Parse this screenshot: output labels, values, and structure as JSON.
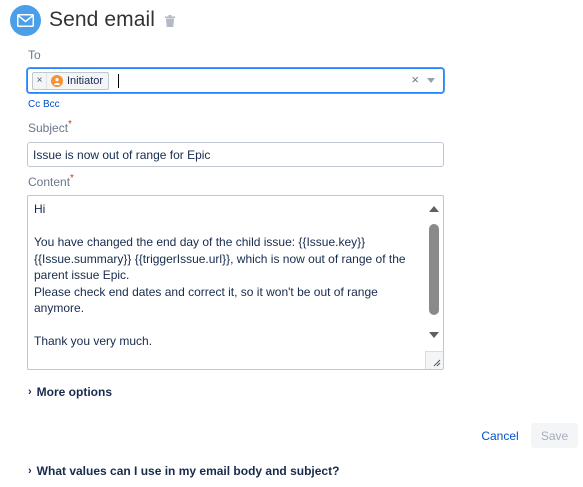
{
  "header": {
    "title": "Send email",
    "icon": "mail-icon",
    "delete_icon": "trash-icon",
    "accent_color": "#4a9fe8"
  },
  "to": {
    "label": "To",
    "chips": [
      {
        "label": "Initiator",
        "remove_label": "×",
        "avatar_icon": "user-avatar-icon"
      }
    ],
    "clear_label": "×"
  },
  "cc_bcc": {
    "label": "Cc Bcc"
  },
  "subject": {
    "label": "Subject",
    "required_marker": "*",
    "value": "Issue is now out of range for Epic"
  },
  "content": {
    "label": "Content",
    "required_marker": "*",
    "value": "Hi\n\nYou have changed the end day of the child issue: {{Issue.key}} {{Issue.summary}} {{triggerIssue.url}}, which is now out of range of the parent issue Epic.\nPlease check end dates and correct it, so it won't be out of range anymore.\n\nThank you very much.\n\nKind Regards"
  },
  "more_options": {
    "chevron": "›",
    "label": "More options"
  },
  "actions": {
    "cancel_label": "Cancel",
    "save_label": "Save"
  },
  "help": {
    "chevron": "›",
    "label": "What values can I use in my email body and subject?"
  }
}
